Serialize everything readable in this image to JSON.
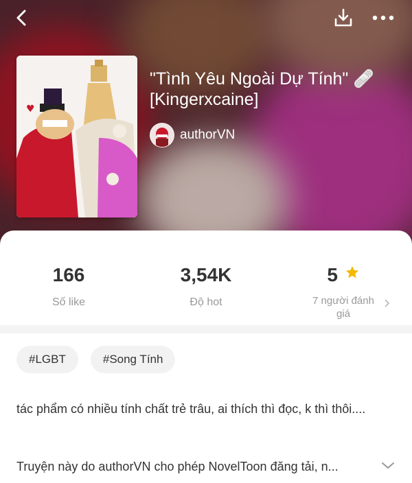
{
  "header": {
    "back_icon": "back-arrow-icon",
    "download_icon": "download-icon",
    "more_icon": "more-dots-icon"
  },
  "book": {
    "title": "\"Tình Yêu Ngoài Dự Tính\" 🩹 [Kingerxcaine]",
    "author": "authorVN"
  },
  "stats": {
    "likes": {
      "value": "166",
      "label": "Số like"
    },
    "hot": {
      "value": "3,54K",
      "label": "Độ hot"
    },
    "rating": {
      "value": "5",
      "label": "7 người đánh giá"
    }
  },
  "tags": [
    "#LGBT",
    "#Song Tính"
  ],
  "description": "tác phẩm có nhiều tính chất trẻ trâu, ai thích thì đọc, k thì thôi....",
  "notice": "Truyện này do authorVN cho phép NovelToon đăng tải, n...",
  "colors": {
    "star": "#f5b800",
    "label_gray": "#999999",
    "tag_bg": "#f2f2f2"
  }
}
